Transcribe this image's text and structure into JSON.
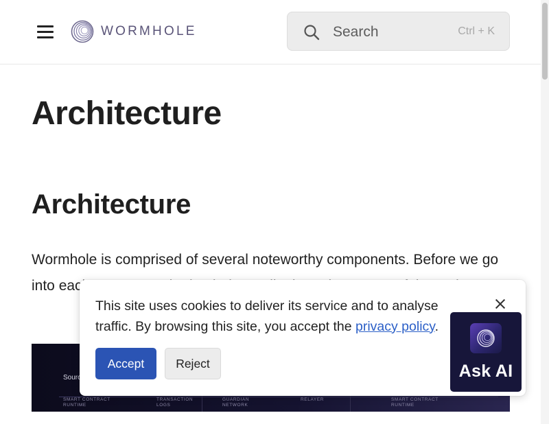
{
  "header": {
    "logo_text": "WORMHOLE",
    "search": {
      "placeholder": "Search",
      "shortcut": "Ctrl + K"
    }
  },
  "main": {
    "page_title": "Architecture",
    "section_title": "Architecture",
    "paragraph": "Wormhole is comprised of several noteworthy components. Before we go into each component in depth, let's talk about the names of the major"
  },
  "diagram": {
    "source_label": "Sourc",
    "labels": [
      "SMART CONTRACT RUNTIME",
      "TRANSACTION LOGS",
      "GUARDIAN NETWORK",
      "RELAYER",
      "SMART CONTRACT RUNTIME"
    ]
  },
  "cookie_banner": {
    "text": "This site uses cookies to deliver its service and to analyse traffic. By browsing this site, you accept the ",
    "link_text": "privacy policy",
    "text_end": ".",
    "accept_label": "Accept",
    "reject_label": "Reject"
  },
  "ask_ai": {
    "label": "Ask AI"
  },
  "colors": {
    "accept_button": "#2b54b4",
    "link": "#2b5fc7",
    "ask_ai_bg": "#17163a",
    "logo_text": "#5a5478"
  }
}
